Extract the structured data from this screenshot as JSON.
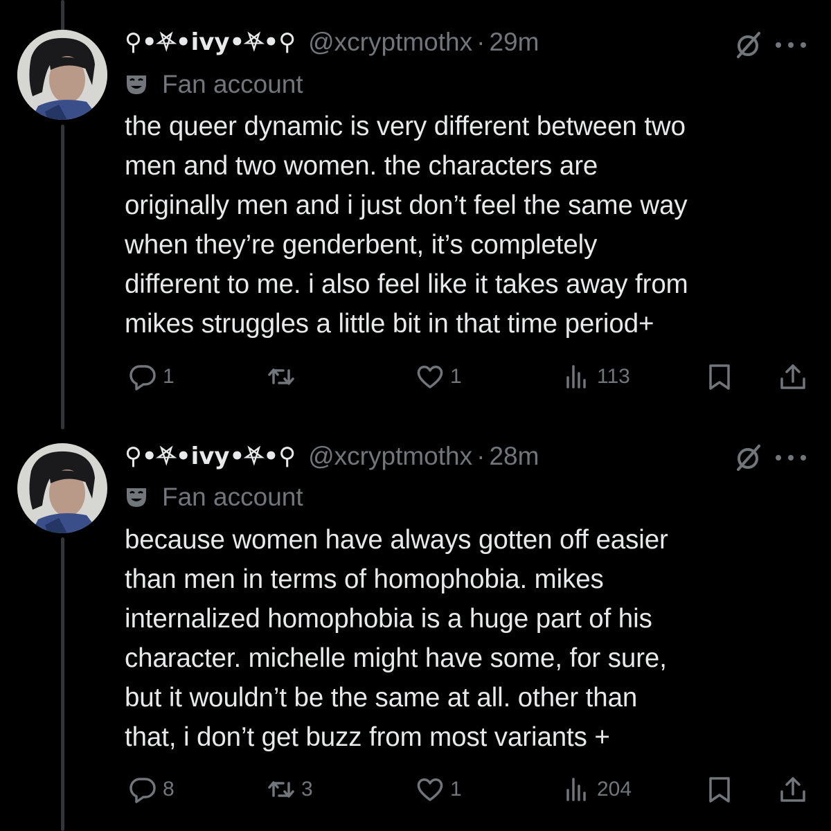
{
  "tweets": [
    {
      "display_name": "⚲•⛧•ivy•⛧•⚲",
      "handle": "@xcryptmothx",
      "separator": "·",
      "time": "29m",
      "label": "Fan account",
      "text": "the queer dynamic is very different between two\nmen and two women. the characters are\noriginally men and i just don’t feel the same way\nwhen they’re genderbent, it’s completely\ndifferent to me. i also feel like it takes away from\nmikes struggles a little bit in that time period+",
      "replies": "1",
      "retweets": "",
      "likes": "1",
      "views": "113"
    },
    {
      "display_name": "⚲•⛧•ivy•⛧•⚲",
      "handle": "@xcryptmothx",
      "separator": "·",
      "time": "28m",
      "label": "Fan account",
      "text": "because women have always gotten off easier\nthan men in terms of homophobia. mikes\ninternalized homophobia is a huge part of his\ncharacter. michelle might have some, for sure,\nbut it wouldn’t be the same at all. other than\nthat, i don’t get buzz from most variants +",
      "replies": "8",
      "retweets": "3",
      "likes": "1",
      "views": "204"
    }
  ],
  "icons": {
    "reply": "reply-icon",
    "retweet": "retweet-icon",
    "like": "heart-icon",
    "views": "views-icon",
    "bookmark": "bookmark-icon",
    "share": "share-icon",
    "grok": "grok-icon",
    "more": "more-icon",
    "label": "theater-mask-icon"
  },
  "colors": {
    "background": "#000000",
    "text": "#e7e9ea",
    "secondary": "#71767b",
    "thread_line": "#333639"
  }
}
